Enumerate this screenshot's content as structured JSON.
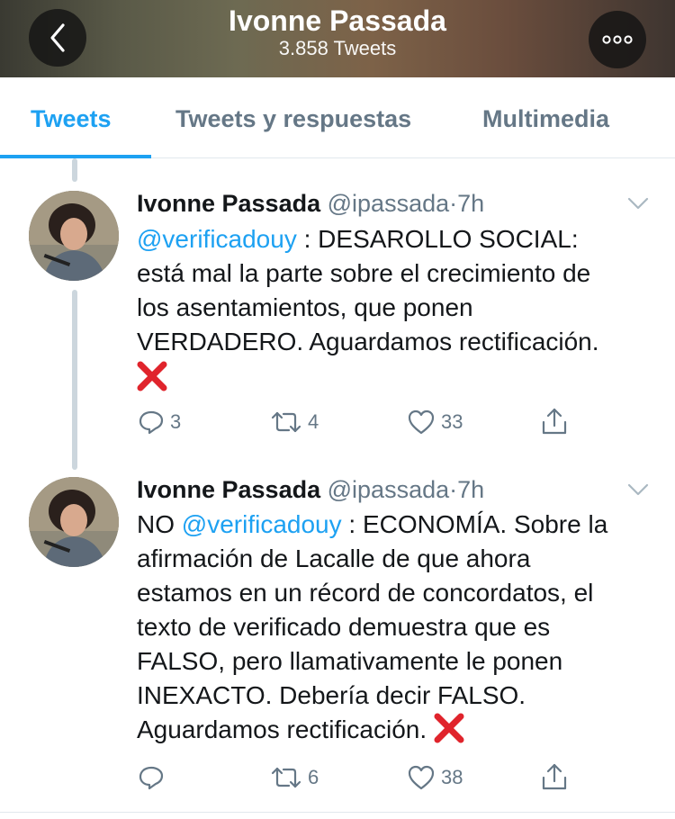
{
  "header": {
    "title": "Ivonne Passada",
    "subtitle": "3.858 Tweets"
  },
  "tabs": [
    {
      "label": "Tweets",
      "active": true
    },
    {
      "label": "Tweets y respuestas",
      "active": false
    },
    {
      "label": "Multimedia",
      "active": false
    }
  ],
  "tweets": [
    {
      "name": "Ivonne Passada",
      "handle": "@ipassada",
      "separator": "·",
      "time": "7h",
      "prefix": "",
      "mention": "@verificadouy",
      "text_line1_rest": " : DESAROLLO SOCIAL:",
      "text_lines": [
        "está mal la parte sobre el crecimiento de",
        "los asentamientos, que ponen",
        "VERDADERO. Aguardamos rectificación."
      ],
      "replies": "3",
      "retweets": "4",
      "likes": "33"
    },
    {
      "name": "Ivonne Passada",
      "handle": "@ipassada",
      "separator": "·",
      "time": "7h",
      "prefix": "NO ",
      "mention": "@verificadouy",
      "text_line1_rest": " : ECONOMÍA. Sobre la",
      "text_lines": [
        "afirmación de Lacalle de que ahora",
        "estamos en un récord de concordatos, el",
        "texto de verificado demuestra que es",
        "FALSO, pero llamativamente le ponen",
        "INEXACTO. Debería decir FALSO.",
        "Aguardamos rectificación. "
      ],
      "replies": "",
      "retweets": "6",
      "likes": "38"
    }
  ],
  "colors": {
    "accent": "#1da1f2",
    "muted": "#657786",
    "cross": "#e0242c"
  },
  "icons": [
    "back-arrow-icon",
    "more-dots-icon",
    "chevron-down-icon",
    "reply-icon",
    "retweet-icon",
    "like-icon",
    "share-icon",
    "cross-mark-icon"
  ]
}
